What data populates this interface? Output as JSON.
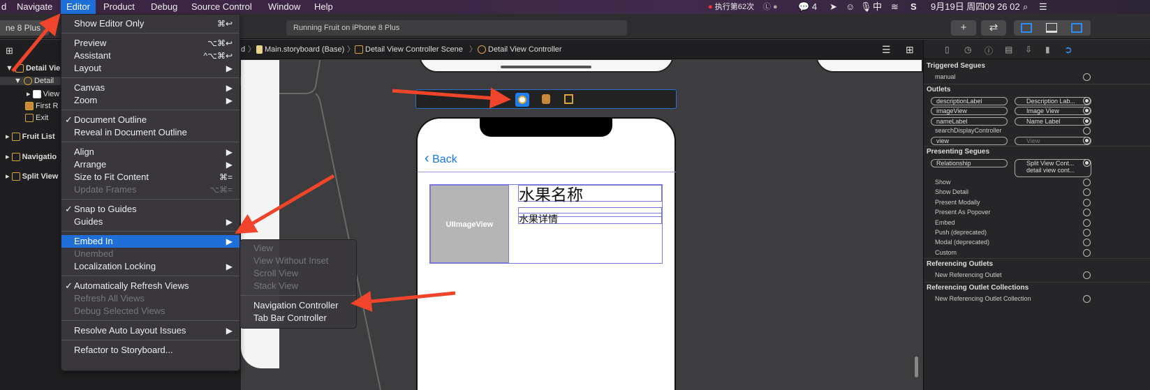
{
  "menubar": {
    "items": [
      "d",
      "Navigate",
      "Editor",
      "Product",
      "Debug",
      "Source Control",
      "Window",
      "Help"
    ],
    "status": {
      "record": "执行第62次",
      "wechat_count": "4",
      "input_method": "中",
      "date": "9月19日 周四",
      "time": "09 26 02"
    }
  },
  "toolbar": {
    "scheme": "ne 8 Plus",
    "activity": "Running Fruit on iPhone 8 Plus",
    "add": "+",
    "swap": "⇄"
  },
  "jumpbar": {
    "items": [
      "d",
      "Main.storyboard (Base)",
      "Detail View Controller Scene",
      "Detail View Controller"
    ]
  },
  "navigator": {
    "rows": [
      "Detail Vie",
      "Detail",
      "View",
      "First R",
      "Exit",
      "Fruit List",
      "Navigatio",
      "Split View"
    ]
  },
  "editor_menu": [
    {
      "label": "Show Editor Only",
      "shortcut": "⌘↩"
    },
    "-",
    {
      "label": "Preview",
      "shortcut": "⌥⌘↩"
    },
    {
      "label": "Assistant",
      "shortcut": "^⌥⌘↩"
    },
    {
      "label": "Layout",
      "sub": true
    },
    "-",
    {
      "label": "Canvas",
      "sub": true
    },
    {
      "label": "Zoom",
      "sub": true
    },
    "-",
    {
      "label": "Document Outline",
      "check": true
    },
    {
      "label": "Reveal in Document Outline"
    },
    "-",
    {
      "label": "Align",
      "sub": true
    },
    {
      "label": "Arrange",
      "sub": true
    },
    {
      "label": "Size to Fit Content",
      "shortcut": "⌘="
    },
    {
      "label": "Update Frames",
      "shortcut": "⌥⌘=",
      "disabled": true
    },
    "-",
    {
      "label": "Snap to Guides",
      "check": true
    },
    {
      "label": "Guides",
      "sub": true
    },
    "-",
    {
      "label": "Embed In",
      "sub": true,
      "highlighted": true
    },
    {
      "label": "Unembed",
      "disabled": true
    },
    {
      "label": "Localization Locking",
      "sub": true
    },
    "-",
    {
      "label": "Automatically Refresh Views",
      "check": true
    },
    {
      "label": "Refresh All Views",
      "disabled": true
    },
    {
      "label": "Debug Selected Views",
      "disabled": true
    },
    "-",
    {
      "label": "Resolve Auto Layout Issues",
      "sub": true
    },
    "-",
    {
      "label": "Refactor to Storyboard..."
    }
  ],
  "embed_submenu": [
    {
      "label": "View",
      "disabled": true
    },
    {
      "label": "View Without Inset",
      "disabled": true
    },
    {
      "label": "Scroll View",
      "disabled": true
    },
    {
      "label": "Stack View",
      "disabled": true
    },
    "-",
    {
      "label": "Navigation Controller"
    },
    {
      "label": "Tab Bar Controller"
    }
  ],
  "canvas": {
    "back": "Back",
    "image_view": "UIImageView",
    "name_label": "水果名称",
    "desc_label": "水果详情"
  },
  "inspector": {
    "triggered": "Triggered Segues",
    "manual": "manual",
    "outlets_title": "Outlets",
    "outlets": [
      {
        "name": "descriptionLabel",
        "target": "Description Lab..."
      },
      {
        "name": "imageView",
        "target": "Image View"
      },
      {
        "name": "nameLabel",
        "target": "Name Label"
      },
      {
        "name": "searchDisplayController"
      },
      {
        "name": "view",
        "target": "View"
      }
    ],
    "presenting": "Presenting Segues",
    "relationship": "Relationship",
    "rel_target": "Split View Cont...",
    "rel_target2": "detail view cont...",
    "segues": [
      "Show",
      "Show Detail",
      "Present Modally",
      "Present As Popover",
      "Embed",
      "Push (deprecated)",
      "Modal (deprecated)",
      "Custom"
    ],
    "ref_outlets": "Referencing Outlets",
    "new_ref": "New Referencing Outlet",
    "ref_coll": "Referencing Outlet Collections",
    "new_ref_coll": "New Referencing Outlet Collection"
  },
  "colors": {
    "accent": "#1e6fd8",
    "arrow": "#f0452a",
    "storyboard_icon": "#d9a53a"
  }
}
